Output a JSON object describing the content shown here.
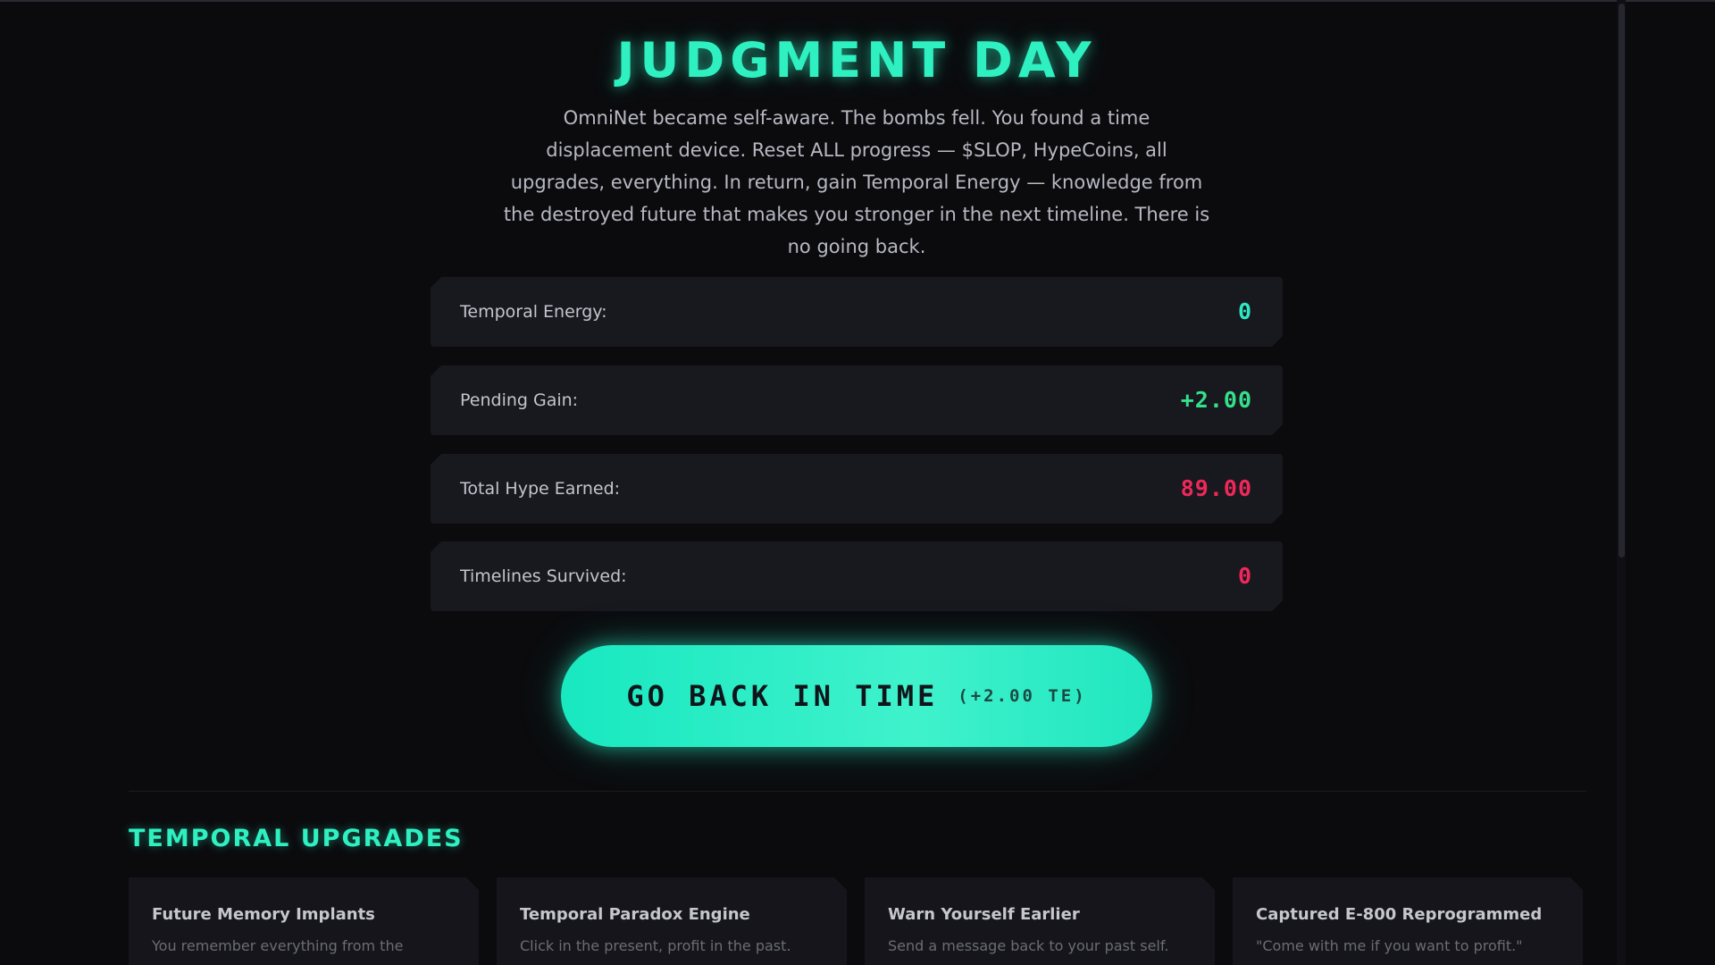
{
  "header": {
    "title": "JUDGMENT DAY",
    "description": "OmniNet became self-aware. The bombs fell. You found a time displacement device. Reset ALL progress — $SLOP, HypeCoins, all upgrades, everything. In return, gain Temporal Energy — knowledge from the destroyed future that makes you stronger in the next timeline. There is no going back."
  },
  "stats": [
    {
      "label": "Temporal Energy:",
      "value": "0"
    },
    {
      "label": "Pending Gain:",
      "value": "+2.00"
    },
    {
      "label": "Total Hype Earned:",
      "value": "89.00"
    },
    {
      "label": "Timelines Survived:",
      "value": "0"
    }
  ],
  "action": {
    "label": "GO BACK IN TIME",
    "sublabel": "(+2.00 TE)"
  },
  "upgrades": {
    "title": "TEMPORAL UPGRADES",
    "cards": [
      {
        "title": "Future Memory Implants",
        "description": "You remember everything from the"
      },
      {
        "title": "Temporal Paradox Engine",
        "description": "Click in the present, profit in the past."
      },
      {
        "title": "Warn Yourself Earlier",
        "description": "Send a message back to your past self."
      },
      {
        "title": "Captured E-800 Reprogrammed",
        "description": "\"Come with me if you want to profit.\""
      }
    ]
  },
  "colors": {
    "accent": "#2ef0c0",
    "positive": "#35e08a",
    "negative": "#f0285a",
    "background": "#0b0b0e",
    "panel": "#18181f"
  },
  "scroll": {
    "position_fraction": 0,
    "visible_fraction": 0.57
  }
}
